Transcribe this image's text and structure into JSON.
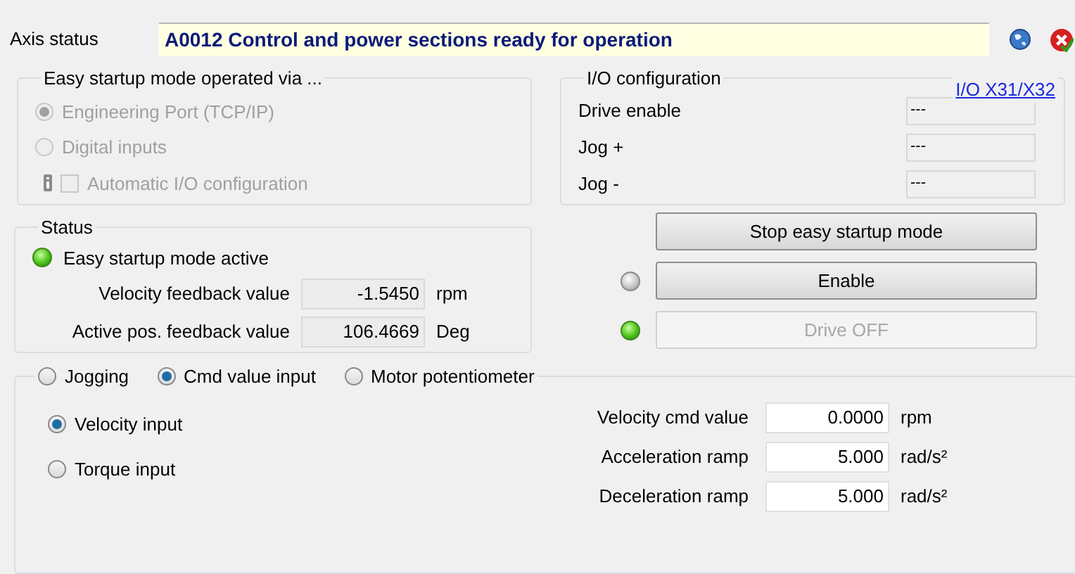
{
  "axis_status": {
    "label": "Axis status",
    "value": "A0012 Control and power sections ready for operation"
  },
  "startup_via": {
    "title": "Easy startup mode operated via ...",
    "options": [
      {
        "label": "Engineering Port (TCP/IP)",
        "selected": true,
        "disabled": true
      },
      {
        "label": "Digital inputs",
        "selected": false,
        "disabled": true
      }
    ],
    "auto_io": {
      "label": "Automatic I/O configuration",
      "checked": false,
      "disabled": true
    }
  },
  "io_config": {
    "title": "I/O configuration",
    "link": "I/O X31/X32",
    "rows": [
      {
        "label": "Drive enable",
        "value": "---"
      },
      {
        "label": "Jog +",
        "value": "---"
      },
      {
        "label": "Jog -",
        "value": "---"
      }
    ]
  },
  "status": {
    "title": "Status",
    "indicator": {
      "label": "Easy startup mode active",
      "lit": true
    },
    "readings": [
      {
        "label": "Velocity feedback value",
        "value": "-1.5450",
        "unit": "rpm"
      },
      {
        "label": "Active pos. feedback value",
        "value": "106.4669",
        "unit": "Deg"
      }
    ]
  },
  "actions": [
    {
      "label": "Stop easy startup mode",
      "disabled": false
    },
    {
      "label": "Enable",
      "disabled": false,
      "lamp_lit": false
    },
    {
      "label": "Drive OFF",
      "disabled": true,
      "lamp_lit": true
    }
  ],
  "mode": {
    "options": [
      {
        "label": "Jogging",
        "selected": false
      },
      {
        "label": "Cmd value input",
        "selected": true
      },
      {
        "label": "Motor potentiometer",
        "selected": false
      }
    ],
    "sub_options": [
      {
        "label": "Velocity input",
        "selected": true
      },
      {
        "label": "Torque input",
        "selected": false
      }
    ],
    "fields": [
      {
        "label": "Velocity cmd value",
        "value": "0.0000",
        "unit": "rpm"
      },
      {
        "label": "Acceleration ramp",
        "value": "5.000",
        "unit": "rad/s²"
      },
      {
        "label": "Deceleration ramp",
        "value": "5.000",
        "unit": "rad/s²"
      }
    ]
  }
}
